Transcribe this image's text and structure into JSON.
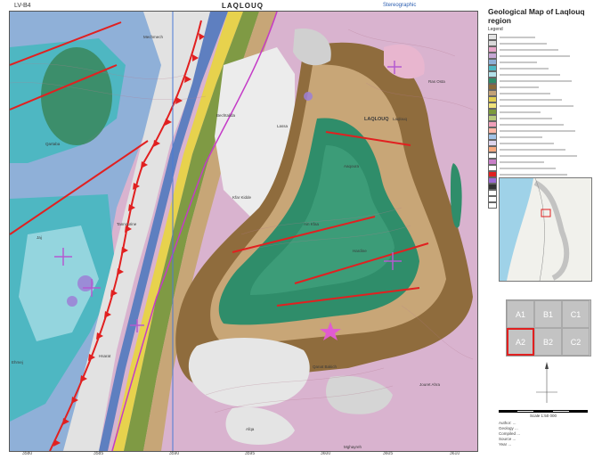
{
  "header": {
    "sheet_code": "LV-B4",
    "map_name": "LAQLOUQ",
    "stereo_label": "Stereographic"
  },
  "map_labels": {
    "cluster": "LAQLOUQ",
    "cities": [
      "Qartaba",
      "Laqlouq",
      "Aaqoura",
      "Hardine",
      "Bechtalida",
      "Jaj",
      "Hsarat",
      "Ehmej",
      "Mechmech",
      "Afqa",
      "Qanat Bakich",
      "Ras Osta",
      "Tannourine",
      "Kfar Kidde",
      "Ain Kfaa",
      "Mghayreh",
      "Lassa",
      "Jouret Ahra"
    ],
    "bottom_ticks": [
      "3580",
      "3585",
      "3590",
      "3595",
      "3600",
      "3605",
      "3610"
    ]
  },
  "legend": {
    "title": "Geological Map of Laqlouq region",
    "heading": "Legend",
    "items": [
      {
        "color": "#e3e3e3",
        "label": ""
      },
      {
        "color": "#d9d9d9",
        "label": ""
      },
      {
        "color": "#e7a6c8",
        "label": ""
      },
      {
        "color": "#c6a7d4",
        "label": ""
      },
      {
        "color": "#8fb0d8",
        "label": ""
      },
      {
        "color": "#4eb7c2",
        "label": ""
      },
      {
        "color": "#b2e1ea",
        "label": ""
      },
      {
        "color": "#2f8d6a",
        "label": ""
      },
      {
        "color": "#8a6a3b",
        "label": ""
      },
      {
        "color": "#c3a277",
        "label": ""
      },
      {
        "color": "#e3cf50",
        "label": ""
      },
      {
        "color": "#f0e27a",
        "label": ""
      },
      {
        "color": "#7c9a3c",
        "label": ""
      },
      {
        "color": "#b7c97b",
        "label": ""
      },
      {
        "color": "#ef9fb9",
        "label": ""
      },
      {
        "color": "#ffb7a6",
        "label": ""
      },
      {
        "color": "#a2c3e6",
        "label": ""
      },
      {
        "color": "#dcd4ec",
        "label": ""
      },
      {
        "color": "#f5a97f",
        "label": ""
      },
      {
        "color": "#ffffff",
        "label": ""
      },
      {
        "color": "#c97fc8",
        "label": ""
      },
      {
        "color": "#ffffff",
        "label": ""
      },
      {
        "color": "#e12020",
        "label": ""
      },
      {
        "color": "#9c6ad4",
        "label": ""
      },
      {
        "color": "#333333",
        "label": ""
      },
      {
        "color": "#ffffff",
        "label": ""
      },
      {
        "color": "#ffffff",
        "label": ""
      },
      {
        "color": "#ffffff",
        "label": ""
      }
    ]
  },
  "index_grid": {
    "cells": [
      "A1",
      "B1",
      "C1",
      "A2",
      "B2",
      "C2"
    ],
    "selected": "A2"
  },
  "scale": {
    "label": "Scale 1:50 000"
  },
  "credits": [
    "Author: ...",
    "Geology ...",
    "Compiled ...",
    "Source ...",
    "Year ..."
  ],
  "colors": {
    "fault_red": "#e12020",
    "thrust_red": "#e12020",
    "road_magenta": "#c43bc7",
    "river_blue": "#2a5db0"
  }
}
